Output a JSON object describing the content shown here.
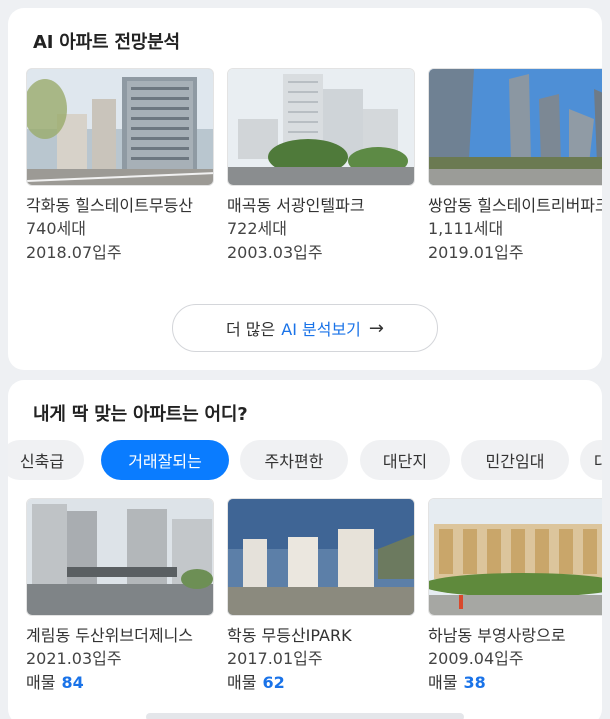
{
  "ai_section": {
    "title": "AI 아파트 전망분석",
    "apartments": [
      {
        "name": "각화동 힐스테이트무등산",
        "units": "740세대",
        "move_in": "2018.07입주"
      },
      {
        "name": "매곡동 서광인텔파크",
        "units": "722세대",
        "move_in": "2003.03입주"
      },
      {
        "name": "쌍암동 힐스테이트리버파크",
        "units": "1,111세대",
        "move_in": "2019.01입주"
      }
    ],
    "more_prefix": "더 많은",
    "more_ai": "AI 분석보기",
    "more_arrow": "→"
  },
  "fit_section": {
    "title": "내게 딱 맞는 아파트는 어디?",
    "chips": [
      "신축급",
      "거래잘되는",
      "주차편한",
      "대단지",
      "민간임대",
      "대"
    ],
    "active_chip": "거래잘되는",
    "apartments": [
      {
        "name": "계림동 두산위브더제니스",
        "move_in": "2021.03입주",
        "listing_label": "매물",
        "listing_count": "84"
      },
      {
        "name": "학동 무등산IPARK",
        "move_in": "2017.01입주",
        "listing_label": "매물",
        "listing_count": "62"
      },
      {
        "name": "하남동 부영사랑으로",
        "move_in": "2009.04입주",
        "listing_label": "매물",
        "listing_count": "38"
      }
    ]
  },
  "colors": {
    "accent": "#0a7cff",
    "link": "#1a73e8",
    "background": "#eef0f3"
  }
}
